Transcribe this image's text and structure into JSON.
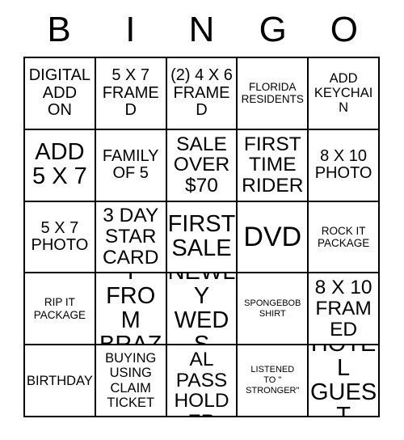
{
  "card": {
    "header_letters": [
      "B",
      "I",
      "N",
      "G",
      "O"
    ],
    "border_color": "#000000",
    "cell_background": "#ffffff",
    "text_color": "#000000",
    "rows": 5,
    "columns": 5,
    "cells": [
      [
        {
          "text": "DIGITAL\nADD\nON",
          "size": "l"
        },
        {
          "text": "5 X 7\nFRAMED",
          "size": "l"
        },
        {
          "text": "(2) 4 X 6\nFRAMED",
          "size": "l"
        },
        {
          "text": "FLORIDA\nRESIDENTS",
          "size": "s"
        },
        {
          "text": "ADD\nKEYCHAIN",
          "size": "m"
        }
      ],
      [
        {
          "text": "ADD\n5 X 7",
          "size": "xxl"
        },
        {
          "text": "FAMILY\nOF 5",
          "size": "l"
        },
        {
          "text": "SALE\nOVER\n$70",
          "size": "xl"
        },
        {
          "text": "FIRST\nTIME\nRIDER",
          "size": "xl"
        },
        {
          "text": "8 X 10\nPHOTO",
          "size": "l"
        }
      ],
      [
        {
          "text": "5 X 7\nPHOTO",
          "size": "l"
        },
        {
          "text": "3 DAY\nSTAR\nCARD",
          "size": "xl"
        },
        {
          "text": "FIRST\nSALE",
          "size": "xxl"
        },
        {
          "text": "DVD",
          "size": "huge"
        },
        {
          "text": "ROCK IT\nPACKAGE",
          "size": "s"
        }
      ],
      [
        {
          "text": "RIP IT\nPACKAGE",
          "size": "s"
        },
        {
          "text": "FAMILY\nFROM\nBRAZIL",
          "size": "xxl"
        },
        {
          "text": "NEWLY\nWEDS",
          "size": "xxl"
        },
        {
          "text": "SPONGEBOB\nSHIRT",
          "size": "xs"
        },
        {
          "text": "8 X 10\nFRAMED",
          "size": "xl"
        }
      ],
      [
        {
          "text": "BIRTHDAY",
          "size": "m"
        },
        {
          "text": "BUYING\nUSING\nCLAIM\nTICKET",
          "size": "m"
        },
        {
          "text": "ANNUAL\nPASS\nHOLDER",
          "size": "xl"
        },
        {
          "text": "LISTENED\nTO \"\nSTRONGER\"",
          "size": "xs"
        },
        {
          "text": "HOTEL\nGUEST",
          "size": "xxl"
        }
      ]
    ]
  }
}
